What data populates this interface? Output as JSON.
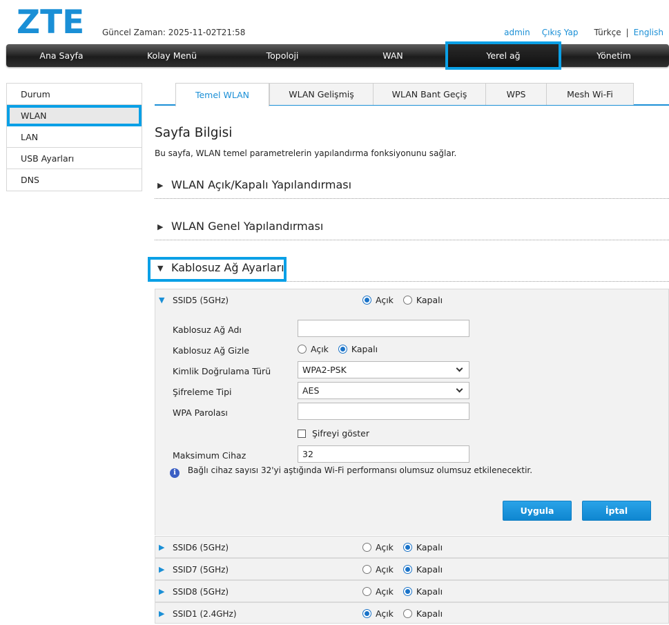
{
  "header": {
    "logo": "ZTE",
    "time_label": "Güncel Zaman: 2025-11-02T21:58",
    "user": "admin",
    "logout": "Çıkış Yap",
    "lang_current": "Türkçe",
    "lang_sep": "|",
    "lang_other": "English"
  },
  "nav": [
    "Ana Sayfa",
    "Kolay Menü",
    "Topoloji",
    "WAN",
    "Yerel ağ",
    "Yönetim"
  ],
  "sidebar": [
    "Durum",
    "WLAN",
    "LAN",
    "USB Ayarları",
    "DNS"
  ],
  "tabs": [
    "Temel WLAN",
    "WLAN Gelişmiş",
    "WLAN Bant Geçiş",
    "WPS",
    "Mesh Wi-Fi"
  ],
  "page": {
    "title": "Sayfa Bilgisi",
    "description": "Bu sayfa, WLAN temel parametrelerin yapılandırma fonksiyonunu sağlar.",
    "section1": "WLAN Açık/Kapalı Yapılandırması",
    "section2": "WLAN Genel Yapılandırması",
    "section3": "Kablosuz Ağ Ayarları"
  },
  "radio": {
    "on": "Açık",
    "off": "Kapalı"
  },
  "ssid_main": {
    "name": "SSID5 (5GHz)",
    "enabled": true,
    "labels": {
      "ssid_name": "Kablosuz Ağ Adı",
      "hide": "Kablosuz Ağ Gizle",
      "auth": "Kimlik Doğrulama Türü",
      "encryption": "Şifreleme Tipi",
      "wpa": "WPA Parolası",
      "show_pw": "Şifreyi göster",
      "max_devices": "Maksimum Cihaz"
    },
    "values": {
      "ssid_name": "",
      "auth": "WPA2-PSK",
      "encryption": "AES",
      "wpa": "",
      "max_devices": "32"
    },
    "info": "Bağlı cihaz sayısı 32'yi aştığında Wi-Fi performansı olumsuz olumsuz etkilenecektir.",
    "apply": "Uygula",
    "cancel": "İptal"
  },
  "ssid_others": [
    {
      "name": "SSID6 (5GHz)",
      "enabled": false
    },
    {
      "name": "SSID7 (5GHz)",
      "enabled": false
    },
    {
      "name": "SSID8 (5GHz)",
      "enabled": false
    },
    {
      "name": "SSID1 (2.4GHz)",
      "enabled": true
    }
  ],
  "colors": {
    "accent": "#1a8fd6",
    "highlight": "#0aa0e6"
  }
}
